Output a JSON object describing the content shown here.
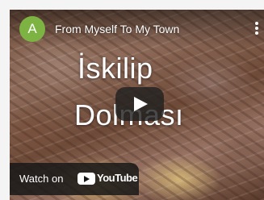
{
  "channel": {
    "avatar_letter": "A",
    "avatar_color": "#7cb342"
  },
  "video": {
    "title": "From Myself To My Town"
  },
  "overlay_text": {
    "line1": "İskilip",
    "line2": "Dolması"
  },
  "player": {
    "watch_on_label": "Watch on",
    "platform_name": "YouTube"
  },
  "icons": [
    "more-vertical-icon",
    "play-icon",
    "youtube-logo-icon"
  ]
}
